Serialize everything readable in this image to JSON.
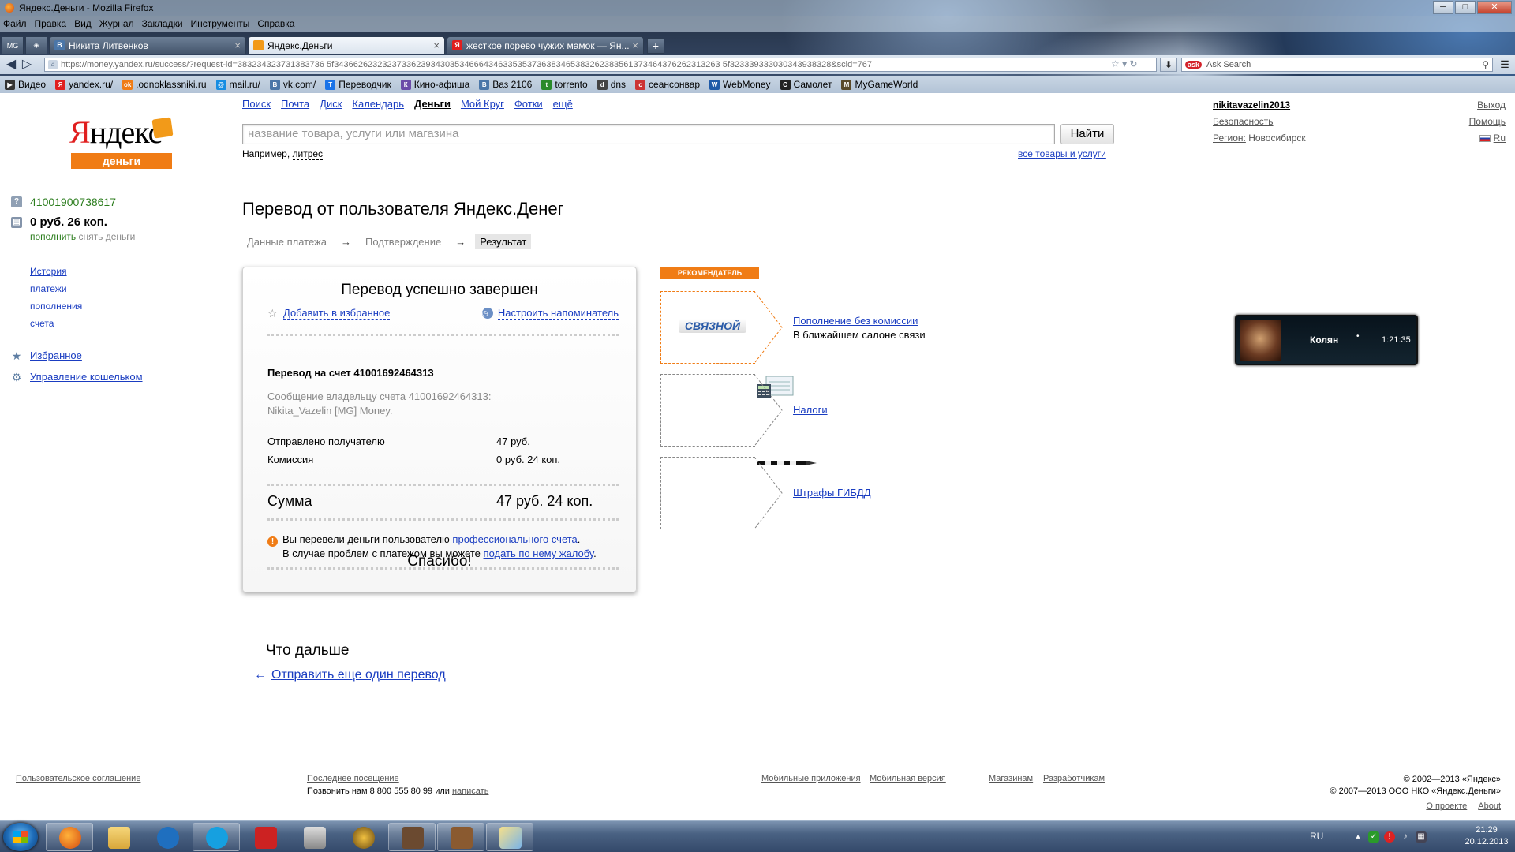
{
  "window": {
    "title": "Яндекс.Деньги - Mozilla Firefox",
    "controls": [
      "─",
      "□",
      "✕"
    ]
  },
  "menu": [
    "Файл",
    "Правка",
    "Вид",
    "Журнал",
    "Закладки",
    "Инструменты",
    "Справка"
  ],
  "tabs": [
    {
      "label": "Никита Литвенков",
      "icon": "vk-icon",
      "icon_color": "#4a76a8",
      "icon_text": "B",
      "active": false
    },
    {
      "label": "Яндекс.Деньги",
      "icon": "yandex-money-icon",
      "icon_color": "#f29a19",
      "icon_text": "",
      "active": true
    },
    {
      "label": "жесткое порево чужих мамок — Ян...",
      "icon": "yandex-icon",
      "icon_color": "#e01f1f",
      "icon_text": "Я",
      "active": false
    }
  ],
  "pinned_tabs": [
    "MG",
    "◈"
  ],
  "url": "https://money.yandex.ru/success/?request-id=38323432373138373653f34366262323237336239343035346664346335353736383465383262383561373464376262313263f323333933303439383328scid=767",
  "url_display": "https://money.yandex.ru/success/?request-id=383234323731383736 5f34366262323237336239343035346664346335353736383465383262383561373464376262313263 5f323339333030343938328&scid=767",
  "search_engine": "Ask Search",
  "bookmarks": [
    {
      "label": "Видео",
      "color": "#333",
      "icon_text": "▶"
    },
    {
      "label": "yandex.ru/",
      "color": "#e01f1f",
      "icon_text": "Я"
    },
    {
      "label": ".odnoklassniki.ru",
      "color": "#f07c15",
      "icon_text": "ok"
    },
    {
      "label": "mail.ru/",
      "color": "#168de2",
      "icon_text": "@"
    },
    {
      "label": "vk.com/",
      "color": "#4a76a8",
      "icon_text": "B"
    },
    {
      "label": "Переводчик",
      "color": "#1a73e8",
      "icon_text": "T"
    },
    {
      "label": "Кино-афиша",
      "color": "#6b4aa8",
      "icon_text": "К"
    },
    {
      "label": "Ваз 2106",
      "color": "#4a76a8",
      "icon_text": "B"
    },
    {
      "label": "torrento",
      "color": "#2a8a2a",
      "icon_text": "t"
    },
    {
      "label": "dns",
      "color": "#444",
      "icon_text": "d"
    },
    {
      "label": "сеансонвар",
      "color": "#c33",
      "icon_text": "с"
    },
    {
      "label": "WebMoney",
      "color": "#1e5aa8",
      "icon_text": "W"
    },
    {
      "label": "Самолет",
      "color": "#222",
      "icon_text": "С"
    },
    {
      "label": "MyGameWorld",
      "color": "#5a4a2a",
      "icon_text": "M"
    }
  ],
  "header": {
    "logo_text_red": "Я",
    "logo_text_black": "ндекс",
    "logo_sub": "деньги",
    "services": [
      {
        "label": "Поиск",
        "current": false
      },
      {
        "label": "Почта",
        "current": false
      },
      {
        "label": "Диск",
        "current": false
      },
      {
        "label": "Календарь",
        "current": false
      },
      {
        "label": "Деньги",
        "current": true
      },
      {
        "label": "Мой Круг",
        "current": false
      },
      {
        "label": "Фотки",
        "current": false
      },
      {
        "label": "ещё",
        "current": false
      }
    ],
    "search_placeholder": "название товара, услуги или магазина",
    "search_button": "Найти",
    "example_prefix": "Например,",
    "example_link": "литрес",
    "all_goods_link": "все товары и услуги",
    "username": "nikitavazelin2013",
    "security_link": "Безопасность",
    "region_label": "Регион:",
    "region_value": "Новосибирск",
    "logout": "Выход",
    "help": "Помощь",
    "lang": "Ru"
  },
  "sidebar": {
    "account_number": "41001900738617",
    "balance": "0 руб. 26 коп.",
    "topup_link": "пополнить",
    "withdraw_link": "снять деньги",
    "nav": [
      "История",
      "платежи",
      "пополнения",
      "счета"
    ],
    "favorites": "Избранное",
    "wallet_mgmt": "Управление кошельком"
  },
  "main": {
    "title": "Перевод от пользователя Яндекс.Денег",
    "steps": [
      "Данные платежа",
      "Подтверждение",
      "Результат"
    ],
    "step_arrow": "→",
    "card": {
      "heading": "Перевод успешно завершен",
      "add_fav": "Добавить в избранное",
      "set_reminder": "Настроить напоминатель",
      "to_account": "Перевод на счет 41001692464313",
      "message_line1": "Сообщение владельцу счета 41001692464313:",
      "message_line2": "Nikita_Vazelin [MG] Money.",
      "sent_label": "Отправлено получателю",
      "sent_value": "47 руб.",
      "fee_label": "Комиссия",
      "fee_value": "0 руб. 24 коп.",
      "sum_label": "Сумма",
      "sum_value": "47 руб. 24 коп.",
      "note_prefix": "Вы перевели деньги пользователю",
      "note_link1": "профессионального счета",
      "note_line2_prefix": "В случае проблем с платежом вы можете",
      "note_link2": "подать по нему жалобу",
      "thanks": "Спасибо!"
    },
    "next_title": "Что дальше",
    "again_link": "Отправить еще один перевод",
    "again_arrow": "←"
  },
  "recommender": {
    "badge": "РЕКОМЕНДАТЕЛЬ",
    "items": [
      {
        "logo": "СВЯЗНОЙ",
        "link": "Пополнение без комиссии",
        "sub": "В ближайшем салоне связи",
        "highlight": true,
        "border_color": "#f07c15"
      },
      {
        "logo": "",
        "link": "Налоги",
        "sub": "",
        "highlight": false,
        "border_color": "#888"
      },
      {
        "logo": "",
        "link": "Штрафы ГИБДД",
        "sub": "",
        "highlight": false,
        "border_color": "#888"
      }
    ]
  },
  "widget": {
    "name": "Колян",
    "time": "1:21:35"
  },
  "footer": {
    "agreement": "Пользовательское соглашение",
    "last_visit": "Последнее посещение",
    "phone_prefix": "Позвонить нам 8 800 555 80 99 или",
    "write": "написать",
    "mobile_apps": "Мобильные приложения",
    "mobile_ver": "Мобильная версия",
    "shops": "Магазинам",
    "devs": "Разработчикам",
    "copy1": "© 2002—2013 «Яндекс»",
    "copy2": "© 2007—2013 ООО НКО «Яндекс.Деньги»",
    "about_project": "О проекте",
    "about": "About"
  },
  "taskbar": {
    "lang": "RU",
    "time": "21:29",
    "date": "20.12.2013"
  }
}
